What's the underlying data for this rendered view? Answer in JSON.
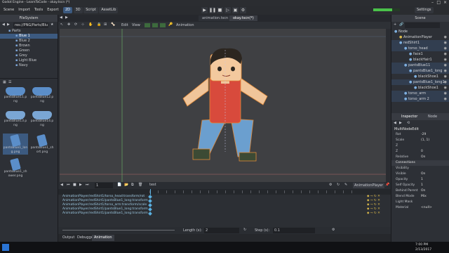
{
  "window": {
    "title": "Godot Engine - LearnToCode - okay.tscn (*)"
  },
  "menu": {
    "items": [
      "Scene",
      "Import",
      "Tools",
      "Export"
    ]
  },
  "workspaces": [
    "2D",
    "3D",
    "Script",
    "AssetLib"
  ],
  "settings_label": "Settings",
  "filesystem": {
    "tab": "FileSystem",
    "path": "res://PNG/Parts/Blu",
    "folders": [
      {
        "label": "Parts",
        "indent": 0,
        "selected": false
      },
      {
        "label": "Blue 1",
        "indent": 1,
        "selected": true
      },
      {
        "label": "Blue 2",
        "indent": 1,
        "selected": false
      },
      {
        "label": "Brown",
        "indent": 1,
        "selected": false
      },
      {
        "label": "Green",
        "indent": 1,
        "selected": false
      },
      {
        "label": "Grey",
        "indent": 1,
        "selected": false
      },
      {
        "label": "Light Blue",
        "indent": 1,
        "selected": false
      },
      {
        "label": "Navy",
        "indent": 1,
        "selected": false
      }
    ],
    "files": [
      {
        "name": "pantsBlue11.p ng",
        "color": "#5b8ec9",
        "kind": "pants"
      },
      {
        "name": "pantsBlue12.p ng",
        "color": "#5b8ec9",
        "kind": "pants"
      },
      {
        "name": "pantsBlue13.p ng",
        "color": "#7aa6d4",
        "kind": "pants"
      },
      {
        "name": "pantsBlue14.p ng",
        "color": "#7aa6d4",
        "kind": "pants"
      },
      {
        "name": "pantsBlue1_lon g.png",
        "color": "#5b8ec9",
        "kind": "leg"
      },
      {
        "name": "pantsBlue1_sh ort.png",
        "color": "#5b8ec9",
        "kind": "leg"
      },
      {
        "name": "pantsBlue1_sh ower.png",
        "color": "#5b8ec9",
        "kind": "leg"
      }
    ]
  },
  "editor": {
    "tabs": [
      {
        "label": "animation.tscn",
        "active": false
      },
      {
        "label": "okay.tscn(*)",
        "active": true
      }
    ],
    "toolbar": {
      "edit": "Edit",
      "view": "View",
      "animation": "Animation"
    }
  },
  "animation_panel": {
    "name": "test",
    "time": "1",
    "player_label": "AnimationPlayer",
    "tracks": [
      "AnimationPlayer/redShirt1/torso_head:transform/rot",
      "AnimationPlayer/redShirt1/pantsBlue1_long:transform",
      "AnimationPlayer/redShirt1/torso_arm:transform/scale",
      "AnimationPlayer/redShirt1/pantsBlue1_long:transform",
      "AnimationPlayer/redShirt1/pantsBlue1_long:transform"
    ],
    "length_label": "Length (s):",
    "length_value": "2",
    "step_label": "Step (s):",
    "step_value": "0.1"
  },
  "bottom_tabs": [
    "Output",
    "Debugger",
    "Animation"
  ],
  "scene_panel": {
    "tab": "Scene",
    "nodes": [
      {
        "label": "Node",
        "indent": 0
      },
      {
        "label": "AnimationPlayer",
        "indent": 1
      },
      {
        "label": "redShirt1",
        "indent": 1
      },
      {
        "label": "torso_head",
        "indent": 2
      },
      {
        "label": "face1",
        "indent": 3
      },
      {
        "label": "blackHair1",
        "indent": 3
      },
      {
        "label": "pantsBlue11",
        "indent": 2
      },
      {
        "label": "pantsBlue1_long",
        "indent": 3
      },
      {
        "label": "blackShoe1",
        "indent": 4
      },
      {
        "label": "pantsBlue1_long1",
        "indent": 3
      },
      {
        "label": "blackShoe1",
        "indent": 4
      },
      {
        "label": "torso_arm",
        "indent": 2
      },
      {
        "label": "torso_arm 2",
        "indent": 2
      }
    ]
  },
  "inspector": {
    "tab": "Inspector",
    "tab2": "Node",
    "object": "MultiNodeEdit",
    "rows": [
      {
        "label": "Rot",
        "value": "-29"
      },
      {
        "label": "Scale",
        "value": "(1, 1)"
      },
      {
        "label": "Z",
        "value": ""
      },
      {
        "label": "Z",
        "value": "0"
      },
      {
        "label": "Relative",
        "value": "On"
      },
      {
        "label": "Visibility",
        "value": ""
      },
      {
        "label": "Visible",
        "value": "On"
      },
      {
        "label": "Opacity",
        "value": "1"
      },
      {
        "label": "Self Opacity",
        "value": "1"
      },
      {
        "label": "Behind Parent",
        "value": "On"
      },
      {
        "label": "Blend Mode",
        "value": "Mix"
      },
      {
        "label": "Light Mask",
        "value": ""
      },
      {
        "label": "Material",
        "value": "<null>"
      }
    ],
    "section": "Connections"
  },
  "taskbar": {
    "time": "7:00 PM",
    "date": "2/13/2017"
  }
}
